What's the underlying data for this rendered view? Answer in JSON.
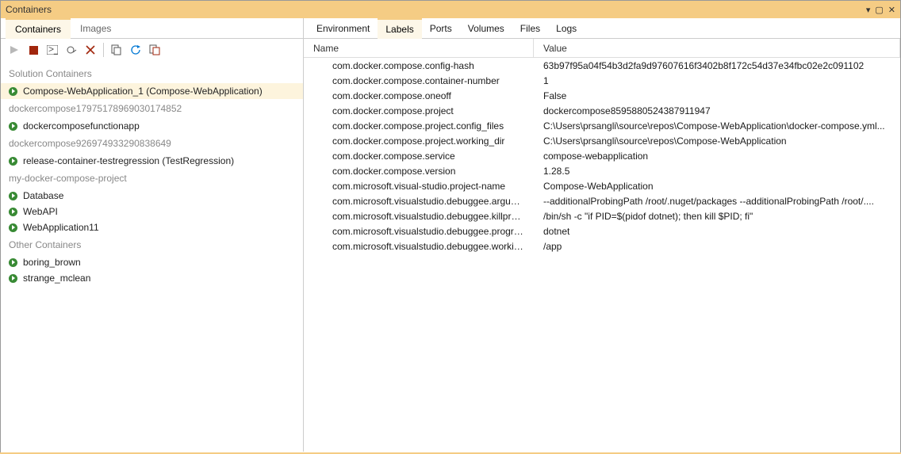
{
  "window": {
    "title": "Containers"
  },
  "left_tabs": [
    {
      "label": "Containers",
      "active": true
    },
    {
      "label": "Images",
      "active": false
    }
  ],
  "right_tabs": [
    {
      "label": "Environment",
      "active": false
    },
    {
      "label": "Labels",
      "active": true
    },
    {
      "label": "Ports",
      "active": false
    },
    {
      "label": "Volumes",
      "active": false
    },
    {
      "label": "Files",
      "active": false
    },
    {
      "label": "Logs",
      "active": false
    }
  ],
  "toolbar_icons": [
    "start",
    "stop",
    "terminal",
    "settings",
    "delete",
    "sep",
    "copy",
    "refresh",
    "prune"
  ],
  "tree": [
    {
      "type": "group",
      "label": "Solution Containers"
    },
    {
      "type": "item",
      "label": "Compose-WebApplication_1 (Compose-WebApplication)",
      "selected": true
    },
    {
      "type": "group",
      "label": "dockercompose17975178969030174852"
    },
    {
      "type": "item",
      "label": "dockercomposefunctionapp"
    },
    {
      "type": "group",
      "label": "dockercompose926974933290838649"
    },
    {
      "type": "item",
      "label": "release-container-testregression (TestRegression)"
    },
    {
      "type": "group",
      "label": "my-docker-compose-project"
    },
    {
      "type": "item",
      "label": "Database"
    },
    {
      "type": "item",
      "label": "WebAPI"
    },
    {
      "type": "item",
      "label": "WebApplication11"
    },
    {
      "type": "group",
      "label": "Other Containers"
    },
    {
      "type": "item",
      "label": "boring_brown"
    },
    {
      "type": "item",
      "label": "strange_mclean"
    }
  ],
  "detail_columns": {
    "name": "Name",
    "value": "Value"
  },
  "labels": [
    {
      "name": "com.docker.compose.config-hash",
      "value": "63b97f95a04f54b3d2fa9d97607616f3402b8f172c54d37e34fbc02e2c091102"
    },
    {
      "name": "com.docker.compose.container-number",
      "value": "1"
    },
    {
      "name": "com.docker.compose.oneoff",
      "value": "False"
    },
    {
      "name": "com.docker.compose.project",
      "value": "dockercompose8595880524387911947"
    },
    {
      "name": "com.docker.compose.project.config_files",
      "value": "C:\\Users\\prsangli\\source\\repos\\Compose-WebApplication\\docker-compose.yml..."
    },
    {
      "name": "com.docker.compose.project.working_dir",
      "value": "C:\\Users\\prsangli\\source\\repos\\Compose-WebApplication"
    },
    {
      "name": "com.docker.compose.service",
      "value": "compose-webapplication"
    },
    {
      "name": "com.docker.compose.version",
      "value": "1.28.5"
    },
    {
      "name": "com.microsoft.visual-studio.project-name",
      "value": "Compose-WebApplication"
    },
    {
      "name": "com.microsoft.visualstudio.debuggee.arguments",
      "value": " --additionalProbingPath /root/.nuget/packages --additionalProbingPath /root/...."
    },
    {
      "name": "com.microsoft.visualstudio.debuggee.killprogram",
      "value": "/bin/sh -c \"if PID=$(pidof dotnet); then kill $PID; fi\""
    },
    {
      "name": "com.microsoft.visualstudio.debuggee.program",
      "value": "dotnet"
    },
    {
      "name": "com.microsoft.visualstudio.debuggee.workingdire...",
      "value": "/app"
    }
  ]
}
